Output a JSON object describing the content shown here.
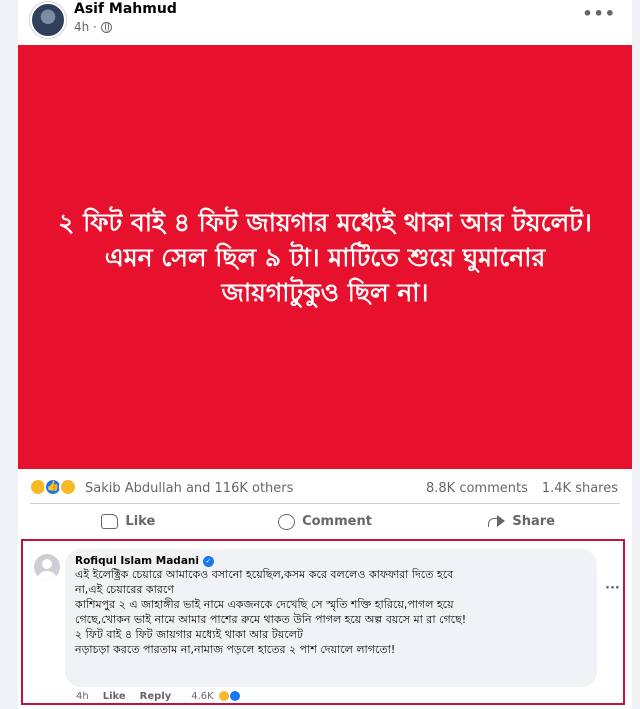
{
  "post": {
    "author": "Asif Mahmud",
    "time": "4h ·",
    "image_text": "২ ফিট বাই ৪ ফিট জায়গার মধ্যেই থাকা আর টয়লেট। এমন সেল ছিল ৯ টা। মাটিতে শুয়ে ঘুমানোর জায়গাটুকুও ছিল না।",
    "image_bg": "#e8112d",
    "reactions_names": "Sakib Abdullah and 116K others",
    "comments_count": "8.8K comments",
    "shares_count": "1.4K shares",
    "reaction_icons": [
      "sad-icon",
      "like-icon",
      "haha-icon"
    ]
  },
  "actions": {
    "like": "Like",
    "comment": "Comment",
    "share": "Share"
  },
  "comment": {
    "author": "Rofiqul Islam Madani",
    "lines": [
      "এই ইলেক্ট্রিক চেয়ারে আমাকেও বসানো হয়েছিল,কসম করে বললেও কাফফারা দিতে হবে",
      "না,এই চেয়ারের কারণে",
      "কাশিমপুর ২ এ জাহাঙ্গীর ভাই নামে একজনকে দেখেছি সে স্মৃতি শক্তি হারিয়ে,পাগল হয়ে",
      "গেছে,খোকন ভাই নামে আমার পাশের রুমে থাকত উনি পাগল হয়ে অল্প বয়সে মা রা গেছে!",
      "২ ফিট বাই ৪ ফিট জায়গার মধ্যেই থাকা আর টয়লেট",
      "নড়াচড়া করতে পারতাম না,নামাজ পড়লে হাতের ২ পাশ দেয়ালে লাগতো!"
    ],
    "time": "4h",
    "like_label": "Like",
    "reply_label": "Reply",
    "reaction_count": "4.6K"
  },
  "colors": {
    "highlight_border": "#c4123f",
    "accent": "#1877f2"
  }
}
